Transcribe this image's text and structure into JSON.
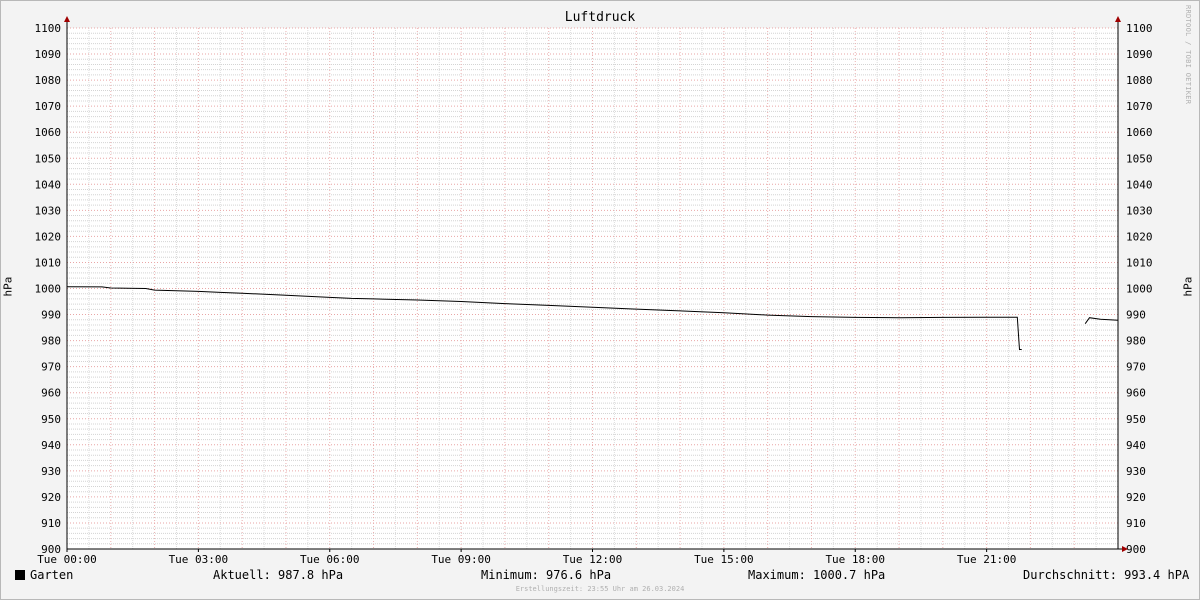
{
  "chart_data": {
    "type": "line",
    "title": "Luftdruck",
    "ylabel": "hPa",
    "ylabel_right": "hPa",
    "ylim": [
      900,
      1100
    ],
    "ytick_step": 10,
    "x_ticks": [
      "Tue 00:00",
      "Tue 03:00",
      "Tue 06:00",
      "Tue 09:00",
      "Tue 12:00",
      "Tue 15:00",
      "Tue 18:00",
      "Tue 21:00"
    ],
    "x_range_hours": [
      0,
      24
    ],
    "grid": true,
    "series": [
      {
        "name": "Garten",
        "color": "#000000",
        "segments": [
          [
            [
              0.0,
              1000.7
            ],
            [
              0.8,
              1000.6
            ],
            [
              1.0,
              1000.2
            ],
            [
              1.8,
              1000.0
            ],
            [
              2.0,
              999.4
            ],
            [
              3.0,
              998.9
            ],
            [
              3.5,
              998.5
            ],
            [
              4.0,
              998.2
            ],
            [
              5.0,
              997.4
            ],
            [
              6.0,
              996.6
            ],
            [
              6.5,
              996.2
            ],
            [
              7.0,
              996.0
            ],
            [
              8.0,
              995.6
            ],
            [
              9.0,
              995.0
            ],
            [
              10.0,
              994.2
            ],
            [
              11.0,
              993.5
            ],
            [
              12.0,
              992.8
            ],
            [
              13.0,
              992.1
            ],
            [
              14.0,
              991.4
            ],
            [
              15.0,
              990.7
            ],
            [
              16.0,
              989.8
            ],
            [
              17.0,
              989.2
            ],
            [
              18.0,
              988.9
            ],
            [
              19.0,
              988.8
            ],
            [
              20.0,
              988.9
            ],
            [
              21.0,
              989.0
            ],
            [
              21.7,
              989.0
            ],
            [
              21.75,
              976.6
            ],
            [
              21.8,
              976.6
            ]
          ],
          [
            [
              23.25,
              986.5
            ],
            [
              23.35,
              988.8
            ],
            [
              23.6,
              988.2
            ],
            [
              24.0,
              987.8
            ]
          ]
        ]
      }
    ]
  },
  "legend": {
    "series_name": "Garten",
    "current": "Aktuell: 987.8 hPa",
    "minimum": "Minimum: 976.6 hPa",
    "maximum": "Maximum: 1000.7 hPa",
    "average": "Durchschnitt: 993.4 hPA"
  },
  "watermark": "RRDTOOL / TOBI OETIKER",
  "footer": "Erstellungszeit: 23:55 Uhr am 26.03.2024",
  "colors": {
    "background": "#f3f3f3",
    "grid_minor": "#cfcfcf",
    "grid_major": "#e8a0a0",
    "axis_arrow": "#a00000"
  }
}
